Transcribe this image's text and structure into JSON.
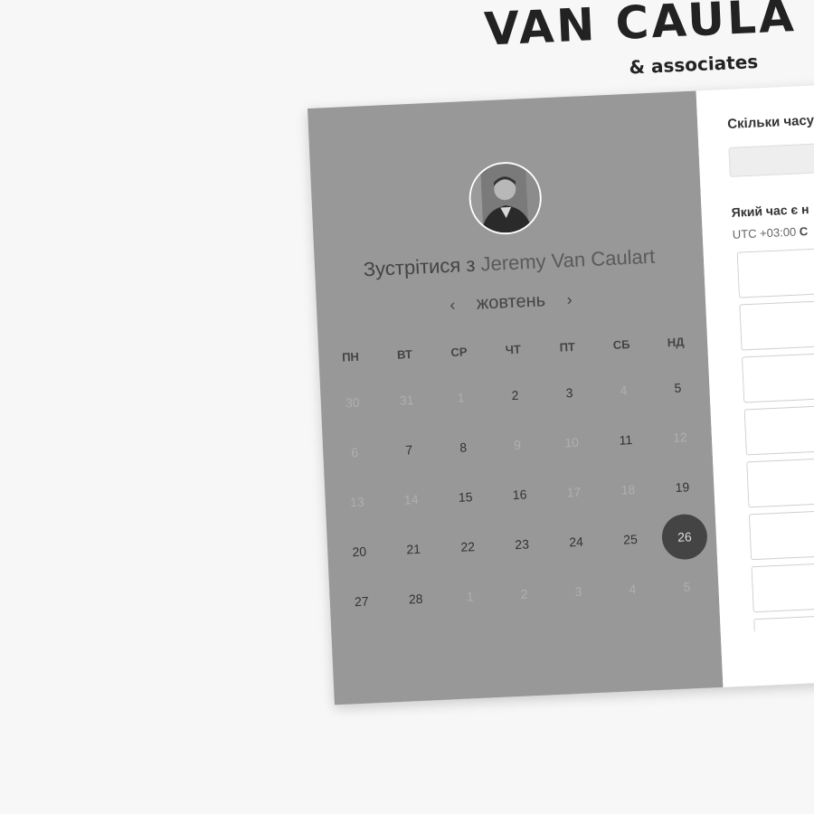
{
  "brand": {
    "name": "VAN CAULA",
    "sub": "& associates"
  },
  "scheduler": {
    "meet_prefix": "Зустрітися з",
    "host": "Jeremy Van Caulart",
    "month": "жовтень",
    "prev_icon": "‹",
    "next_icon": "›",
    "weekdays": [
      "ПН",
      "ВТ",
      "СР",
      "ЧТ",
      "ПТ",
      "СБ",
      "НД"
    ],
    "days": [
      {
        "d": "30",
        "state": "off"
      },
      {
        "d": "31",
        "state": "off"
      },
      {
        "d": "1",
        "state": "off"
      },
      {
        "d": "2",
        "state": "avail"
      },
      {
        "d": "3",
        "state": "avail"
      },
      {
        "d": "4",
        "state": "off"
      },
      {
        "d": "5",
        "state": "avail"
      },
      {
        "d": "6",
        "state": "off"
      },
      {
        "d": "7",
        "state": "avail"
      },
      {
        "d": "8",
        "state": "avail"
      },
      {
        "d": "9",
        "state": "off"
      },
      {
        "d": "10",
        "state": "off"
      },
      {
        "d": "11",
        "state": "avail"
      },
      {
        "d": "12",
        "state": "off"
      },
      {
        "d": "13",
        "state": "off"
      },
      {
        "d": "14",
        "state": "off"
      },
      {
        "d": "15",
        "state": "avail"
      },
      {
        "d": "16",
        "state": "avail"
      },
      {
        "d": "17",
        "state": "off"
      },
      {
        "d": "18",
        "state": "off"
      },
      {
        "d": "19",
        "state": "avail"
      },
      {
        "d": "20",
        "state": "avail"
      },
      {
        "d": "21",
        "state": "avail"
      },
      {
        "d": "22",
        "state": "avail"
      },
      {
        "d": "23",
        "state": "avail"
      },
      {
        "d": "24",
        "state": "avail"
      },
      {
        "d": "25",
        "state": "avail"
      },
      {
        "d": "26",
        "state": "selected"
      },
      {
        "d": "27",
        "state": "avail"
      },
      {
        "d": "28",
        "state": "avail"
      },
      {
        "d": "1",
        "state": "off"
      },
      {
        "d": "2",
        "state": "off"
      },
      {
        "d": "3",
        "state": "off"
      },
      {
        "d": "4",
        "state": "off"
      },
      {
        "d": "5",
        "state": "off"
      }
    ]
  },
  "booking": {
    "duration_question": "Скільки часу",
    "time_question": "Який час є н",
    "timezone_offset": "UTC +03:00",
    "timezone_city": "C",
    "slot_count": 8
  },
  "colors": {
    "left_panel": "#989898",
    "selected_day": "#444444",
    "background": "#f7f7f7"
  }
}
